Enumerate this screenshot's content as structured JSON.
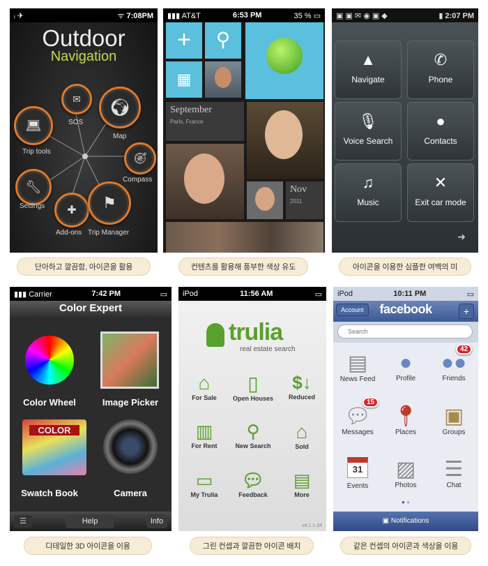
{
  "screens": {
    "outdoor": {
      "status": {
        "time": "7:08PM"
      },
      "title_line1": "Outdoor",
      "title_line2": "Navigation",
      "items": [
        "SOS",
        "Map",
        "Trip tools",
        "Compass",
        "Settings",
        "Add-ons",
        "Trip Manager"
      ],
      "accent": "#e07a2a"
    },
    "metro": {
      "status": {
        "carrier": "AT&T",
        "time": "6:53 PM",
        "battery": "35 %"
      },
      "september": "September",
      "location": "Paris, France",
      "nov": "Nov",
      "year": "2011",
      "accent": "#5bc0de"
    },
    "android": {
      "status": {
        "time": "2:07 PM"
      },
      "items": [
        "Navigate",
        "Phone",
        "Voice Search",
        "Contacts",
        "Music",
        "Exit car mode"
      ]
    },
    "color_expert": {
      "status": {
        "carrier": "Carrier",
        "time": "7:42 PM"
      },
      "title": "Color Expert",
      "items": [
        "Color Wheel",
        "Image Picker",
        "Swatch Book",
        "Camera"
      ],
      "swatch_text": "COLOR",
      "bottom": {
        "help": "Help",
        "info": "Info"
      }
    },
    "trulia": {
      "status": {
        "device": "iPod",
        "time": "11:56 AM"
      },
      "brand": "trulia",
      "tagline": "real estate search",
      "items": [
        "For Sale",
        "Open Houses",
        "Reduced",
        "For Rent",
        "New Search",
        "Sold",
        "My Trulia",
        "Feedback",
        "More"
      ],
      "version": "v4.1.1-34",
      "accent": "#5aa02c"
    },
    "facebook": {
      "status": {
        "device": "iPod",
        "time": "10:11 PM"
      },
      "account_btn": "Account",
      "title": "facebook",
      "search_placeholder": "Search",
      "items": [
        "News Feed",
        "Profile",
        "Friends",
        "Messages",
        "Places",
        "Groups",
        "Events",
        "Photos",
        "Chat"
      ],
      "badges": {
        "friends": "42",
        "messages": "15"
      },
      "event_day": "31",
      "notifications": "Notifications",
      "accent": "#3b5998"
    }
  },
  "captions": [
    "단아하고 깔끔함, 아이콘을 활용",
    "컨텐츠를 활용해 풍부한 색상 유도",
    "아이콘을 이용한 심플한 여백의 미",
    "디테일한 3D 아이콘을 이용",
    "그린 컨셉과 깔끔한 아이콘 배치",
    "같은 컨셉의 아이콘과 색상을 이용"
  ]
}
